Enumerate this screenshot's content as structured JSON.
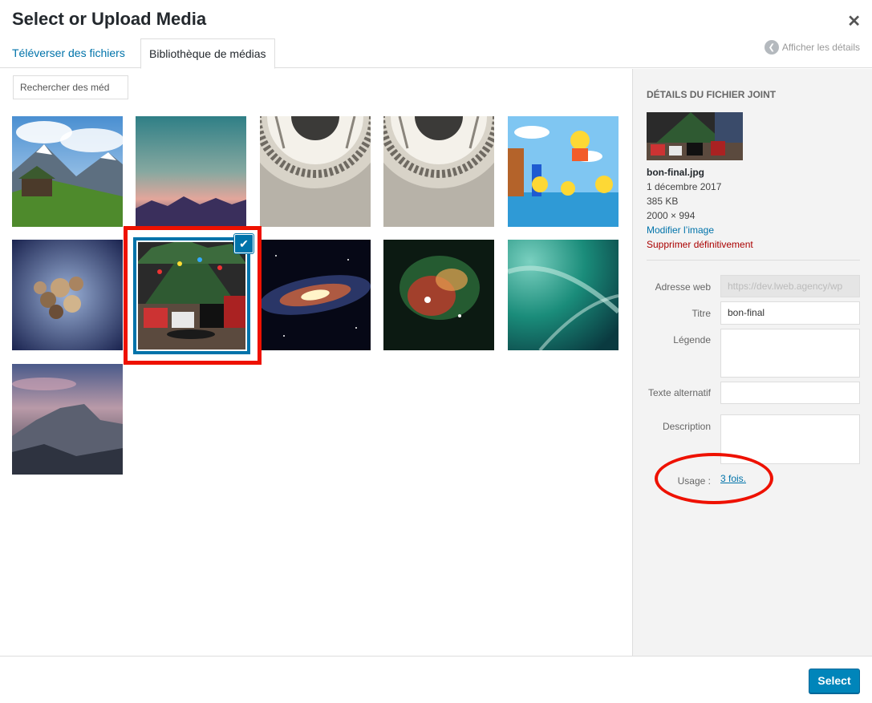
{
  "window": {
    "title": "Select or Upload Media"
  },
  "tabs": [
    {
      "label": "Téléverser des fichiers"
    },
    {
      "label": "Bibliothèque de médias"
    }
  ],
  "details_toggle": {
    "label": "Afficher les détails"
  },
  "search": {
    "placeholder": "Rechercher des méd"
  },
  "media_items": [
    {
      "icon": "mountain-cabin-landscape"
    },
    {
      "icon": "pastel-gradient-mountains"
    },
    {
      "icon": "dome-ceiling"
    },
    {
      "icon": "dome-ceiling"
    },
    {
      "icon": "simpsons-cartoon"
    },
    {
      "icon": "dried-flowers"
    },
    {
      "icon": "christmas-tree-presents",
      "selected": true
    },
    {
      "icon": "galaxy"
    },
    {
      "icon": "nebula"
    },
    {
      "icon": "teal-wave"
    },
    {
      "icon": "half-dome-mountain"
    }
  ],
  "sidebar": {
    "heading": "Détails du fichier joint",
    "filename": "bon-final.jpg",
    "date": "1 décembre 2017",
    "filesize": "385 KB",
    "dimensions": "2000 × 994",
    "edit_link": "Modifier l’image",
    "delete_link": "Supprimer définitivement",
    "fields": {
      "url_label": "Adresse web",
      "url_value": "https://dev.lweb.agency/wp",
      "title_label": "Titre",
      "title_value": "bon-final",
      "caption_label": "Légende",
      "caption_value": "",
      "alt_label": "Texte alternatif",
      "alt_value": "",
      "description_label": "Description",
      "description_value": ""
    },
    "usage_label": "Usage :",
    "usage_link": "3 fois."
  },
  "footer": {
    "select_label": "Select"
  },
  "colors": {
    "accent": "#0073aa",
    "button": "#0085ba",
    "annotation_red": "#ee1100",
    "delete": "#aa0000"
  }
}
